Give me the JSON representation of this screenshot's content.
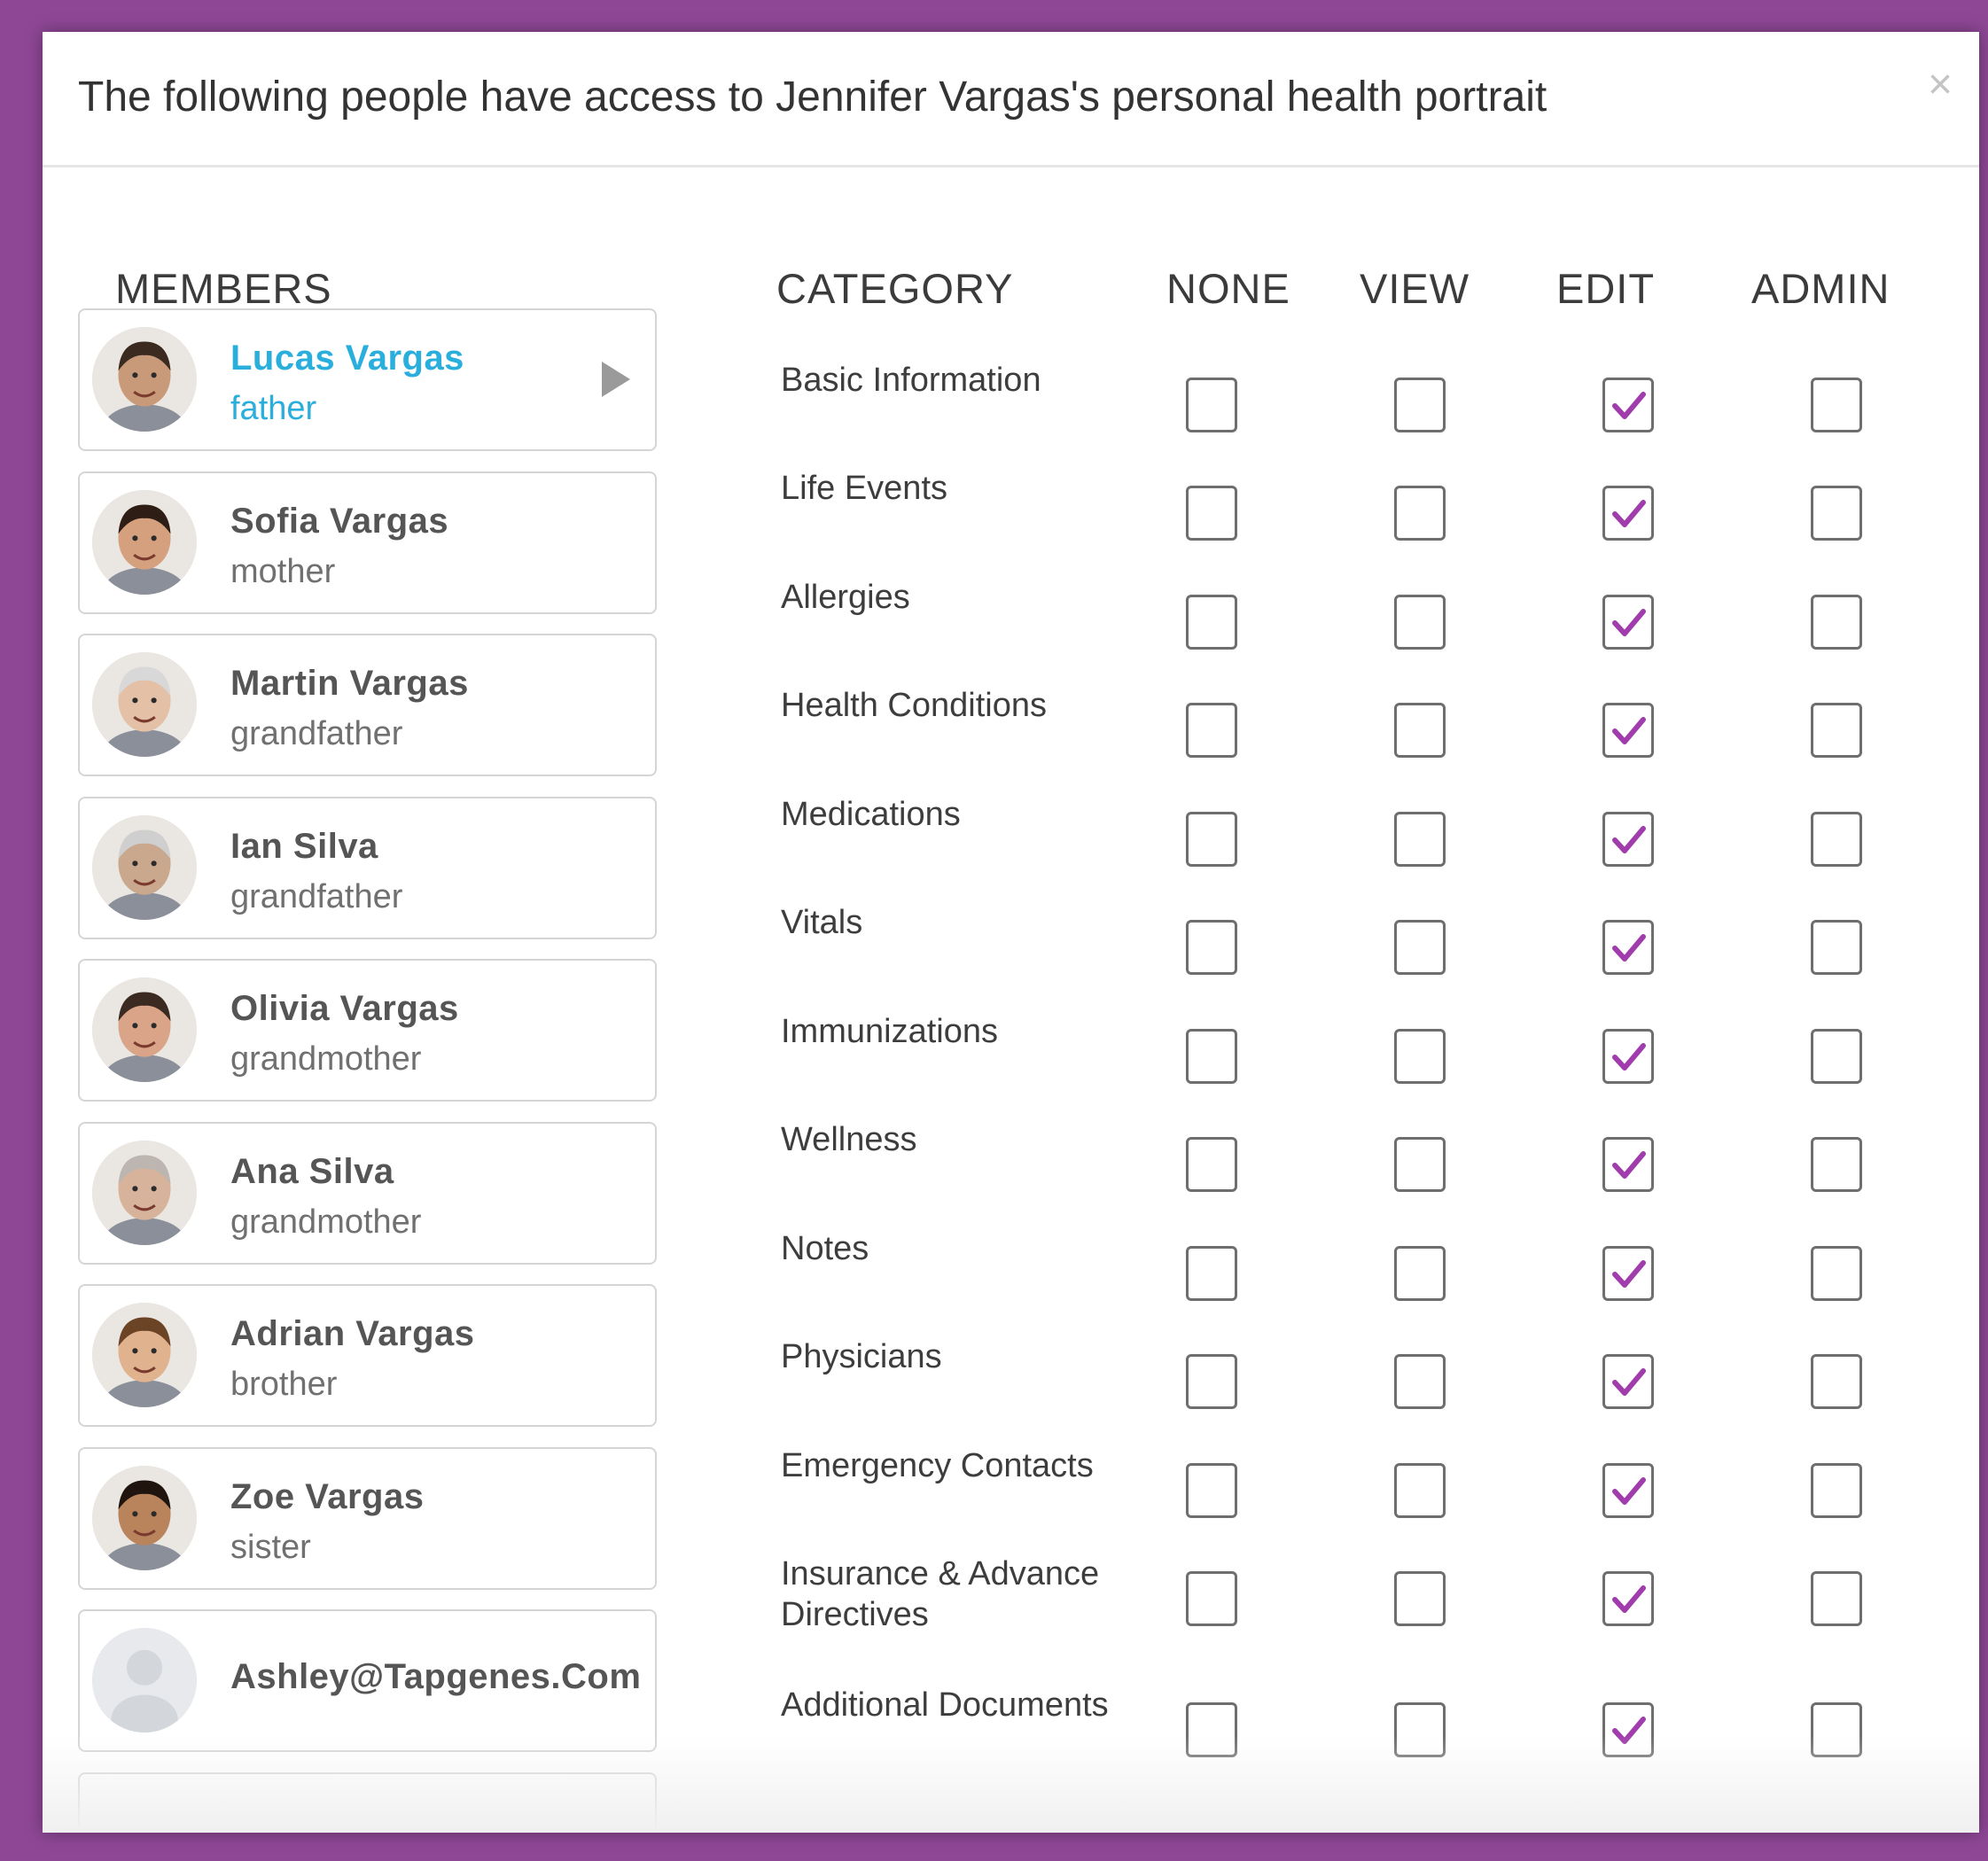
{
  "modal": {
    "title": "The following people have access to Jennifer Vargas's personal health portrait",
    "close_label": "×"
  },
  "headers": {
    "members": "MEMBERS",
    "category": "CATEGORY",
    "none": "NONE",
    "view": "VIEW",
    "edit": "EDIT",
    "admin": "ADMIN"
  },
  "members": [
    {
      "name": "Lucas Vargas",
      "role": "father",
      "active": true,
      "avatar": "face-man-glasses",
      "skin": "#c99a7a",
      "hair": "#3a2a20"
    },
    {
      "name": "Sofia Vargas",
      "role": "mother",
      "active": false,
      "avatar": "face-woman",
      "skin": "#d4a07e",
      "hair": "#2e1d14"
    },
    {
      "name": "Martin Vargas",
      "role": "grandfather",
      "active": false,
      "avatar": "face-elderly-man",
      "skin": "#e3c0a6",
      "hair": "#d8d8d8"
    },
    {
      "name": "Ian Silva",
      "role": "grandfather",
      "active": false,
      "avatar": "face-elderly-man",
      "skin": "#c9a88e",
      "hair": "#cfcfcf"
    },
    {
      "name": "Olivia Vargas",
      "role": "grandmother",
      "active": false,
      "avatar": "face-woman",
      "skin": "#d9a488",
      "hair": "#3b2a22"
    },
    {
      "name": "Ana Silva",
      "role": "grandmother",
      "active": false,
      "avatar": "face-elderly-woman",
      "skin": "#d6b39a",
      "hair": "#bdb6b0"
    },
    {
      "name": "Adrian Vargas",
      "role": "brother",
      "active": false,
      "avatar": "face-boy",
      "skin": "#e1b28e",
      "hair": "#6b4426"
    },
    {
      "name": "Zoe Vargas",
      "role": "sister",
      "active": false,
      "avatar": "face-girl",
      "skin": "#b9835c",
      "hair": "#1f140e"
    },
    {
      "name": "Ashley@Tapgenes.Com",
      "role": "",
      "active": false,
      "avatar": "default-user-icon",
      "skin": "#d9dde2",
      "hair": "#d9dde2"
    }
  ],
  "levels": [
    "none",
    "view",
    "edit",
    "admin"
  ],
  "categories": [
    {
      "label": "Basic Information",
      "level": "edit"
    },
    {
      "label": "Life Events",
      "level": "edit"
    },
    {
      "label": "Allergies",
      "level": "edit"
    },
    {
      "label": "Health Conditions",
      "level": "edit"
    },
    {
      "label": "Medications",
      "level": "edit"
    },
    {
      "label": "Vitals",
      "level": "edit"
    },
    {
      "label": "Immunizations",
      "level": "edit"
    },
    {
      "label": "Wellness",
      "level": "edit"
    },
    {
      "label": "Notes",
      "level": "edit"
    },
    {
      "label": "Physicians",
      "level": "edit"
    },
    {
      "label": "Emergency Contacts",
      "level": "edit"
    },
    {
      "label": "Insurance & Advance Directives",
      "level": "edit"
    },
    {
      "label": "Additional Documents",
      "level": "edit"
    }
  ],
  "colors": {
    "accent_purple": "#8e4795",
    "active_blue": "#2aaedc",
    "check_purple": "#a03cac"
  }
}
